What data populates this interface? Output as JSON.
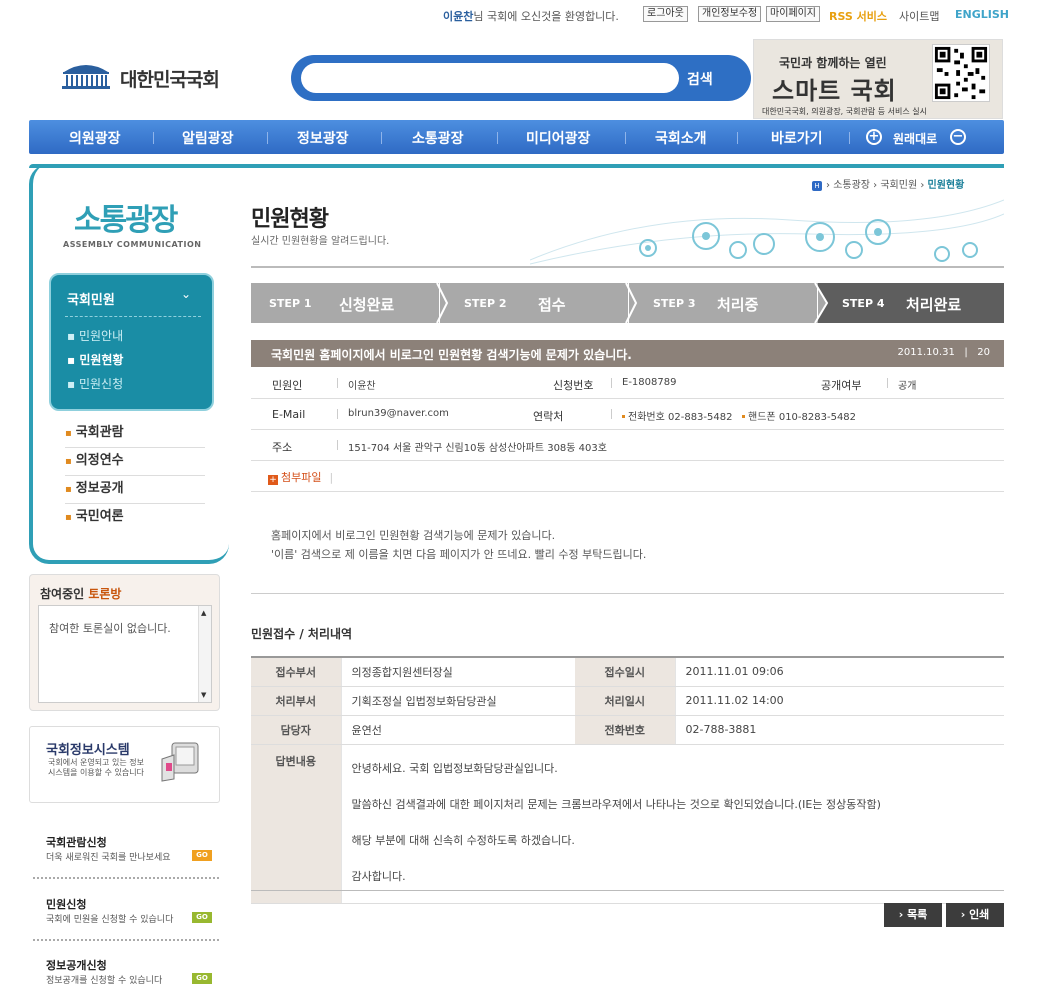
{
  "util": {
    "user_name": "이윤찬",
    "welcome_suffix": "님 국회에 오신것을 환영합니다.",
    "logout": "로그아웃",
    "edit_info": "개인정보수정",
    "my_page": "마이페이지",
    "rss": "RSS 서비스",
    "sitemap": "사이트맵",
    "english": "ENGLISH"
  },
  "logo": {
    "text": "대한민국국회"
  },
  "search": {
    "button": "검색",
    "value": ""
  },
  "banner": {
    "line1": "국민과 함께하는 열린",
    "line2": "스마트 국회",
    "line3": "대한민국국회, 의원광장, 국회관람 등 서비스 실시"
  },
  "gnb": {
    "items": [
      "의원광장",
      "알림광장",
      "정보광장",
      "소통광장",
      "미디어광장",
      "국회소개",
      "바로가기"
    ],
    "zoom_label": "원래대로"
  },
  "lnb": {
    "title": "소통광장",
    "subtitle": "ASSEMBLY COMMUNICATION",
    "selected": {
      "heading": "국회민원",
      "subs": [
        "민원안내",
        "민원현황",
        "민원신청"
      ],
      "active_sub": "민원현황"
    },
    "menus": [
      "국회관람",
      "의정연수",
      "정보공개",
      "국민여론"
    ]
  },
  "discussion": {
    "title_prefix": "참여중인 ",
    "title_em": "토론방",
    "empty_text": "참여한 토론실이 없습니다."
  },
  "info_system": {
    "title": "국회정보시스템",
    "desc": "국회에서 운영되고 있는 정보시스템을 이용할 수 있습니다"
  },
  "banners": [
    {
      "title": "국회관람신청",
      "desc": "더욱 새로워진 국회를 만나보세요",
      "go": "GO",
      "color": "#f0a020"
    },
    {
      "title": "민원신청",
      "desc": "국회에 민원을 신청할 수 있습니다",
      "go": "GO",
      "color": "#98b830"
    },
    {
      "title": "정보공개신청",
      "desc": "정보공개를 신청할 수 있습니다",
      "go": "GO",
      "color": "#98b830"
    }
  ],
  "breadcrumb": {
    "items": [
      "소통광장",
      "국회민원"
    ],
    "current": "민원현황"
  },
  "page": {
    "title": "민원현황",
    "subtitle": "실시간 민원현황을 알려드립니다."
  },
  "steps": [
    {
      "num": "STEP 1",
      "label": "신청완료"
    },
    {
      "num": "STEP 2",
      "label": "접수"
    },
    {
      "num": "STEP 3",
      "label": "처리중"
    },
    {
      "num": "STEP 4",
      "label": "처리완료"
    }
  ],
  "petition": {
    "subject": "국회민원 홈페이지에서 비로그인 민원현황 검색기능에 문제가 있습니다.",
    "date": "2011.10.31",
    "views": "20",
    "labels": {
      "petitioner": "민원인",
      "app_no": "신청번호",
      "public": "공개여부",
      "email": "E-Mail",
      "contact": "연락처",
      "address": "주소",
      "attach": "첨부파일"
    },
    "petitioner": "이윤찬",
    "app_no": "E-1808789",
    "public": "공개",
    "email": "blrun39@naver.com",
    "phone_label": "전화번호",
    "phone": "02-883-5482",
    "mobile_label": "핸드폰",
    "mobile": "010-8283-5482",
    "address": "151-704 서울 관악구 신림10동 삼성산아파트 308동 403호",
    "body": [
      "홈페이지에서 비로그인 민원현황 검색기능에 문제가 있습니다.",
      "'이름' 검색으로 제 이름을 치면 다음 페이지가 안 뜨네요. 빨리 수정 부탁드립니다."
    ]
  },
  "process": {
    "title": "민원접수 / 처리내역",
    "labels": {
      "recv_dept": "접수부서",
      "recv_date": "접수일시",
      "proc_dept": "처리부서",
      "proc_date": "처리일시",
      "manager": "담당자",
      "tel": "전화번호",
      "answer": "답변내용"
    },
    "recv_dept": "의정종합지원센터장실",
    "recv_date": "2011.11.01 09:06",
    "proc_dept": "기획조정실 입법정보화담당관실",
    "proc_date": "2011.11.02 14:00",
    "manager": "윤연선",
    "tel": "02-788-3881",
    "answer": [
      "안녕하세요. 국회 입법정보화담당관실입니다.",
      "말씀하신 검색결과에 대한 페이지처리 문제는 크롬브라우져에서 나타나는 것으로 확인되었습니다.(IE는 정상동작함)",
      "해당 부분에 대해 신속히 수정하도록 하겠습니다.",
      "감사합니다."
    ]
  },
  "buttons": {
    "list": "목록",
    "print": "인쇄"
  },
  "colors": {
    "accent": "#2f9fb6",
    "gnb": "#2f6ac4"
  }
}
